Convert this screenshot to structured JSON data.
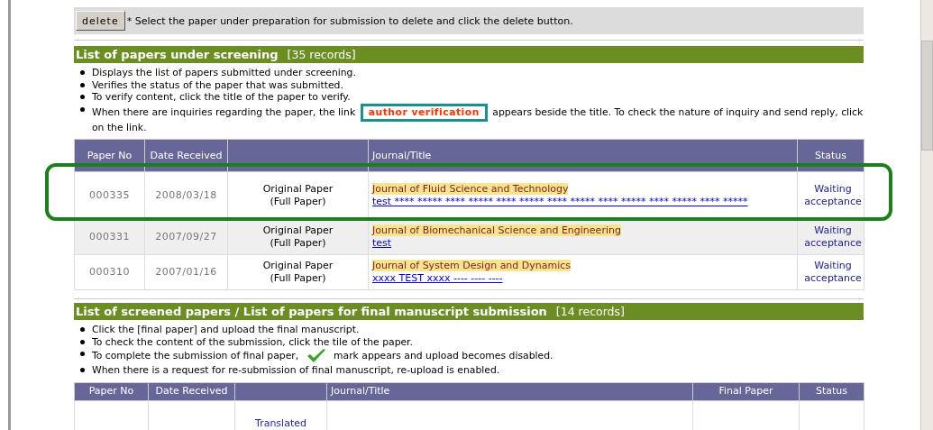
{
  "delete_bar": {
    "button": "delete",
    "note": "* Select the paper under preparation for submission to delete and click the delete button."
  },
  "screening": {
    "title": "List of papers under screening",
    "count": "[35 records]",
    "bullets": [
      {
        "parts": [
          {
            "kind": "text",
            "text": "Displays the list of papers submitted under screening."
          }
        ]
      },
      {
        "parts": [
          {
            "kind": "text",
            "text": "Verifies the status of the paper that was submitted."
          }
        ]
      },
      {
        "parts": [
          {
            "kind": "text",
            "text": "To verify content, click the title of the paper to verify."
          }
        ]
      },
      {
        "parts": [
          {
            "kind": "text",
            "text": "When there are inquiries regarding the paper, the link"
          },
          {
            "kind": "badge",
            "text": "author verification"
          },
          {
            "kind": "text",
            "text": "appears beside the title. To check the nature of inquiry and send reply, click on the link."
          }
        ]
      }
    ],
    "columns": [
      "Paper No",
      "Date Received",
      "",
      "Journal/Title",
      "Status"
    ],
    "rows": [
      {
        "paper_no": "000335",
        "date": "2008/03/18",
        "type": "Original Paper (Full Paper)",
        "journal": "Journal of Fluid Science and Technology",
        "title": "test **** ***** **** ***** **** ***** **** ***** **** ***** **** ***** **** *****",
        "status": "Waiting acceptance",
        "highlighted": true
      },
      {
        "paper_no": "000331",
        "date": "2007/09/27",
        "type": "Original Paper (Full Paper)",
        "journal": "Journal of Biomechanical Science and Engineering",
        "title": "test",
        "status": "Waiting acceptance",
        "highlighted": false
      },
      {
        "paper_no": "000310",
        "date": "2007/01/16",
        "type": "Original Paper (Full Paper)",
        "journal": "Journal of System Design and Dynamics",
        "title": "xxxx TEST xxxx ---- ---- ----",
        "status": "Waiting acceptance",
        "highlighted": false
      }
    ]
  },
  "screened": {
    "title": "List of screened papers / List of papers for final manuscript submission",
    "count": "[14 records]",
    "bullets": [
      {
        "parts": [
          {
            "kind": "text",
            "text": "Click the [final paper] and upload the final manuscript."
          }
        ]
      },
      {
        "parts": [
          {
            "kind": "text",
            "text": "To check the content of the submission, click the tile of the paper."
          }
        ]
      },
      {
        "parts": [
          {
            "kind": "text",
            "text": "To complete the submission of final paper,"
          },
          {
            "kind": "check"
          },
          {
            "kind": "text",
            "text": "mark appears and upload becomes disabled."
          }
        ]
      },
      {
        "parts": [
          {
            "kind": "text",
            "text": "When there is a request for re-submission of final manuscript, re-upload is enabled."
          }
        ]
      }
    ],
    "columns": [
      "Paper No",
      "Date Received",
      "",
      "Journal/Title",
      "Final Paper",
      "Status"
    ],
    "rows": [
      {
        "cells": [
          "",
          "",
          "Translated",
          "",
          "",
          ""
        ]
      }
    ]
  }
}
